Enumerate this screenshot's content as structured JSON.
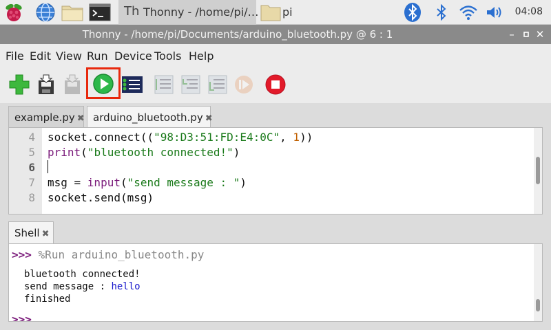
{
  "taskbar": {
    "thonny_task": "Thonny  -  /home/pi/…",
    "pi_task": "pi",
    "clock": "04:08"
  },
  "window": {
    "title": "Thonny  -  /home/pi/Documents/arduino_bluetooth.py  @  6 : 1",
    "controls": [
      "minimize-icon",
      "maximize-icon",
      "close-icon"
    ]
  },
  "menu": [
    "File",
    "Edit",
    "View",
    "Run",
    "Device",
    "Tools",
    "Help"
  ],
  "toolbar": {
    "buttons": [
      "new-icon",
      "save-icon",
      "save-as-icon",
      "run-icon",
      "debug-icon",
      "step-over-icon",
      "step-into-icon",
      "step-out-icon",
      "resume-icon",
      "stop-icon"
    ],
    "highlight_color": "#e8280c"
  },
  "editor": {
    "tabs": [
      {
        "label": "example.py",
        "close": "✖"
      },
      {
        "label": "arduino_bluetooth.py",
        "close": "✖"
      }
    ],
    "line_numbers": [
      "4",
      "5",
      "6",
      "7",
      "8"
    ],
    "lines": [
      "socket.connect((\"98:D3:51:FD:E4:0C\", 1))",
      "print(\"bluetooth connected!\")",
      "",
      "msg = input(\"send message : \")",
      "socket.send(msg)"
    ],
    "tokens": {
      "l4a": "socket.connect((",
      "l4b": "\"98:D3:51:FD:E4:0C\"",
      "l4c": ", ",
      "l4d": "1",
      "l4e": "))",
      "l5a": "print",
      "l5b": "(",
      "l5c": "\"bluetooth connected!\"",
      "l5d": ")",
      "l7a": "msg = ",
      "l7b": "input",
      "l7c": "(",
      "l7d": "\"send message : \"",
      "l7e": ")",
      "l8a": "socket.send(msg)"
    }
  },
  "shell": {
    "tab_label": "Shell",
    "tab_close": "✖",
    "prompt": ">>>",
    "run_command": "%Run arduino_bluetooth.py",
    "output": {
      "line1": "bluetooth connected!",
      "line2_label": "send message : ",
      "line2_input": "hello",
      "line3": "finished"
    },
    "next_prompt": ">>>"
  }
}
